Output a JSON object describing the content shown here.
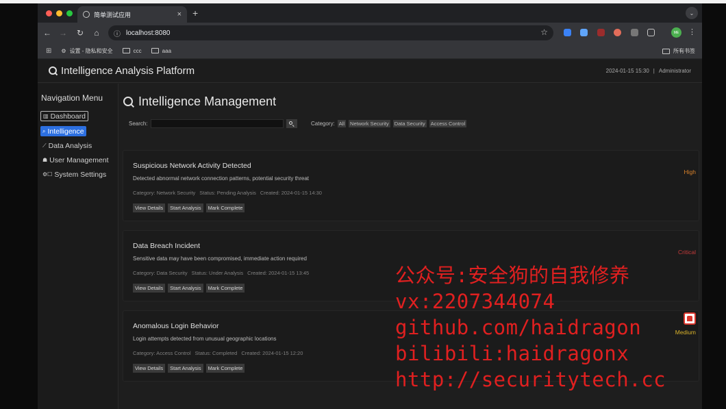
{
  "browser": {
    "tab_title": "简单测试应用",
    "url": "localhost:8080",
    "bookmarks": [
      "设置 - 隐私和安全",
      "ccc",
      "aaa"
    ],
    "bookmarks_right": "所有书签",
    "profile_initials": "ME"
  },
  "header": {
    "title": "Intelligence Analysis Platform",
    "datetime": "2024-01-15 15:30",
    "separator": "|",
    "user": "Administrator"
  },
  "sidebar": {
    "title": "Navigation Menu",
    "items": [
      {
        "label": "Dashboard",
        "icon": "bar-chart-icon",
        "glyph": "▥"
      },
      {
        "label": "Intelligence",
        "icon": "search-icon",
        "glyph": "⌕"
      },
      {
        "label": "Data Analysis",
        "icon": "line-chart-icon",
        "glyph": "⟋"
      },
      {
        "label": "User Management",
        "icon": "users-icon",
        "glyph": "☗"
      },
      {
        "label": "System Settings",
        "icon": "gear-icon",
        "glyph": "⚙☐"
      }
    ]
  },
  "main": {
    "title": "Intelligence Management",
    "search_label": "Search:",
    "search_value": "",
    "category_label": "Category:",
    "categories": [
      "All",
      "Network Security",
      "Data Security",
      "Access Control"
    ],
    "cards": [
      {
        "title": "Suspicious Network Activity Detected",
        "description": "Detected abnormal network connection patterns, potential security threat",
        "category": "Category: Network Security",
        "status": "Status: Pending Analysis",
        "created": "Created: 2024-01-15 14:30",
        "priority": "High",
        "priority_color": "#d9822b",
        "actions": [
          "View Details",
          "Start Analysis",
          "Mark Complete"
        ]
      },
      {
        "title": "Data Breach Incident",
        "description": "Sensitive data may have been compromised, immediate action required",
        "category": "Category: Data Security",
        "status": "Status: Under Analysis",
        "created": "Created: 2024-01-15 13:45",
        "priority": "Critical",
        "priority_color": "#c43a3a",
        "actions": [
          "View Details",
          "Start Analysis",
          "Mark Complete"
        ]
      },
      {
        "title": "Anomalous Login Behavior",
        "description": "Login attempts detected from unusual geographic locations",
        "category": "Category: Access Control",
        "status": "Status: Completed",
        "created": "Created: 2024-01-15 12:20",
        "priority": "Medium",
        "priority_color": "#d9b22b",
        "actions": [
          "View Details",
          "Start Analysis",
          "Mark Complete"
        ]
      }
    ]
  },
  "watermark": {
    "lines": [
      "公众号:安全狗的自我修养",
      "vx:2207344074",
      "github.com/haidragon",
      "bilibili:haidragonx",
      "http://securitytech.cc"
    ]
  }
}
